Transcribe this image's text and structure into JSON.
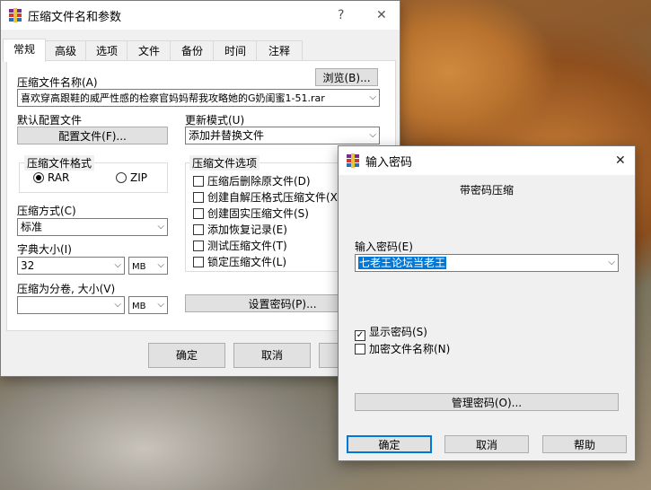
{
  "main_dialog": {
    "title": "压缩文件名和参数",
    "help_symbol": "?",
    "close_symbol": "✕",
    "tabs": [
      "常规",
      "高级",
      "选项",
      "文件",
      "备份",
      "时间",
      "注释"
    ],
    "archive_name_label": "压缩文件名称(A)",
    "browse_button": "浏览(B)...",
    "archive_name_value": "喜欢穿高跟鞋的威严性感的检察官妈妈帮我攻略她的G奶闺蜜1-51.rar",
    "default_profile_label": "默认配置文件",
    "profile_button": "配置文件(F)...",
    "update_mode_label": "更新模式(U)",
    "update_mode_value": "添加并替换文件",
    "format_group_label": "压缩文件格式",
    "format_rar": "RAR",
    "format_zip": "ZIP",
    "options_group_label": "压缩文件选项",
    "options": [
      "压缩后删除原文件(D)",
      "创建自解压格式压缩文件(X)",
      "创建固实压缩文件(S)",
      "添加恢复记录(E)",
      "测试压缩文件(T)",
      "锁定压缩文件(L)"
    ],
    "method_label": "压缩方式(C)",
    "method_value": "标准",
    "dict_label": "字典大小(I)",
    "dict_value": "32",
    "dict_unit": "MB",
    "split_label": "压缩为分卷, 大小(V)",
    "split_value": "",
    "split_unit": "MB",
    "set_password_button": "设置密码(P)...",
    "ok_button": "确定",
    "cancel_button": "取消"
  },
  "password_dialog": {
    "title": "输入密码",
    "close_symbol": "✕",
    "heading": "带密码压缩",
    "password_label": "输入密码(E)",
    "password_value": "七老王论坛当老王",
    "show_password_label": "显示密码(S)",
    "show_password_checked": true,
    "encrypt_names_label": "加密文件名称(N)",
    "encrypt_names_checked": false,
    "manage_button": "管理密码(O)...",
    "ok_button": "确定",
    "cancel_button": "取消",
    "help_button": "帮助"
  }
}
